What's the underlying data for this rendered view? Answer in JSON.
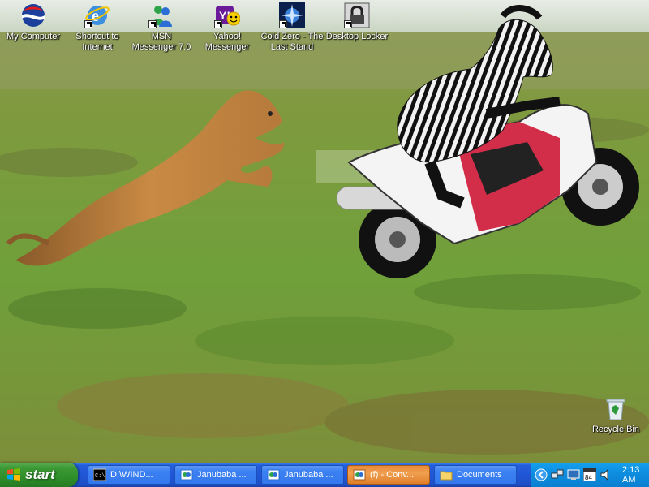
{
  "desktop": {
    "icons": [
      {
        "label": "My Computer",
        "icon": "my-computer-icon"
      },
      {
        "label": "Shortcut to Internet",
        "icon": "internet-explorer-icon"
      },
      {
        "label": "MSN Messenger 7.0",
        "icon": "msn-messenger-icon"
      },
      {
        "label": "Yahoo! Messenger",
        "icon": "yahoo-messenger-icon"
      },
      {
        "label": "Cold Zero - The Last Stand",
        "icon": "cold-zero-icon"
      },
      {
        "label": "Desktop Locker",
        "icon": "lock-icon"
      },
      {
        "label": "Recycle Bin",
        "icon": "recycle-bin-icon"
      }
    ],
    "wallpaper": "lioness-chasing-zebra-on-motorcycle"
  },
  "taskbar": {
    "start_label": "start",
    "tasks": [
      {
        "label": "D:\\WIND...",
        "icon": "command-prompt-icon",
        "active": false
      },
      {
        "label": "Janubaba ...",
        "icon": "messenger-window-icon",
        "active": false
      },
      {
        "label": "Janubaba ...",
        "icon": "messenger-window-icon",
        "active": false
      },
      {
        "label": "(f) - Conv...",
        "icon": "conversation-icon",
        "active": true
      },
      {
        "label": "Documents",
        "icon": "folder-icon",
        "active": false
      }
    ],
    "tray": {
      "icons": [
        "chevron-left-icon",
        "network-icon",
        "display-icon",
        "calendar-icon",
        "speaker-icon"
      ],
      "calendar_day": "84",
      "clock": "2:13 AM"
    }
  },
  "colors": {
    "taskbar_blue": "#245edb",
    "start_green": "#3c9a35",
    "active_task_orange": "#e68a3a",
    "tray_blue": "#0e8ee0"
  }
}
